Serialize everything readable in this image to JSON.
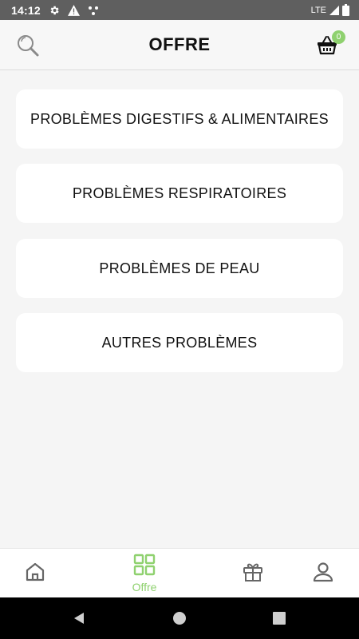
{
  "status_bar": {
    "time": "14:12",
    "network": "LTE",
    "icons": [
      "settings-gear-icon",
      "alert-warning-icon",
      "dots-notification-icon",
      "signal-icon",
      "battery-icon"
    ]
  },
  "header": {
    "title": "OFFRE",
    "search_icon": "search-icon",
    "cart_icon": "basket-icon",
    "cart_count": "0",
    "accent_color": "#8fd16f"
  },
  "categories": [
    {
      "label": "PROBLÈMES DIGESTIFS & ALIMENTAIRES"
    },
    {
      "label": "PROBLÈMES RESPIRATOIRES"
    },
    {
      "label": "PROBLÈMES DE PEAU"
    },
    {
      "label": "AUTRES PROBLÈMES"
    }
  ],
  "bottom_nav": {
    "items": [
      {
        "icon": "home-icon",
        "label": "",
        "active": false
      },
      {
        "icon": "grid-icon",
        "label": "Offre",
        "active": true
      },
      {
        "icon": "gift-icon",
        "label": "",
        "active": false
      },
      {
        "icon": "profile-icon",
        "label": "",
        "active": false
      }
    ],
    "active_color": "#8fd16f",
    "inactive_color": "#666666"
  },
  "system_nav": {
    "icons": [
      "back-icon",
      "home-circle-icon",
      "recent-apps-icon"
    ]
  }
}
